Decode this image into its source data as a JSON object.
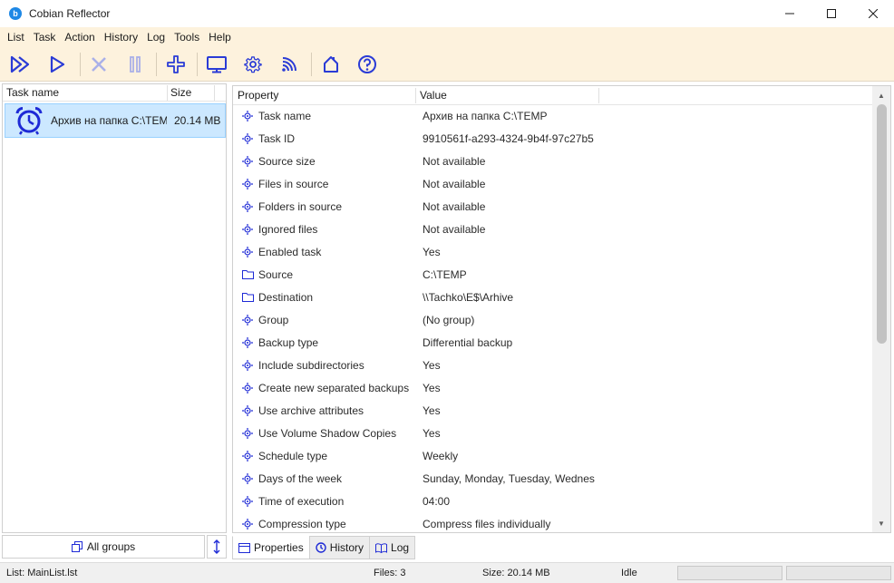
{
  "window": {
    "title": "Cobian Reflector",
    "app_icon_glyph": "b"
  },
  "menu": [
    "List",
    "Task",
    "Action",
    "History",
    "Log",
    "Tools",
    "Help"
  ],
  "toolbar_icons": [
    "run-all-icon",
    "run-icon",
    "stop-icon",
    "pause-icon",
    "add-task-icon",
    "monitor-icon",
    "settings-gear-icon",
    "network-signal-icon",
    "home-icon",
    "help-icon"
  ],
  "task_list": {
    "columns": {
      "name": "Task name",
      "size": "Size"
    },
    "tasks": [
      {
        "name": "Архив на папка C:\\TEMP",
        "size": "20.14 MB",
        "icon": "alarm-clock-icon"
      }
    ],
    "groups_button": "All groups"
  },
  "properties": {
    "columns": {
      "property": "Property",
      "value": "Value"
    },
    "rows": [
      {
        "name": "Task name",
        "value": "Архив на папка C:\\TEMP",
        "icon": "property-icon"
      },
      {
        "name": "Task ID",
        "value": "9910561f-a293-4324-9b4f-97c27b5",
        "icon": "property-icon"
      },
      {
        "name": "Source size",
        "value": "Not available",
        "icon": "property-icon"
      },
      {
        "name": "Files in source",
        "value": "Not available",
        "icon": "property-icon"
      },
      {
        "name": "Folders in source",
        "value": "Not available",
        "icon": "property-icon"
      },
      {
        "name": "Ignored files",
        "value": "Not available",
        "icon": "property-icon"
      },
      {
        "name": "Enabled task",
        "value": "Yes",
        "icon": "property-icon"
      },
      {
        "name": "Source",
        "value": "C:\\TEMP",
        "icon": "folder-icon"
      },
      {
        "name": "Destination",
        "value": "\\\\Tachko\\E$\\Arhive",
        "icon": "folder-icon"
      },
      {
        "name": "Group",
        "value": "(No group)",
        "icon": "property-icon"
      },
      {
        "name": "Backup type",
        "value": "Differential backup",
        "icon": "property-icon"
      },
      {
        "name": "Include subdirectories",
        "value": "Yes",
        "icon": "property-icon"
      },
      {
        "name": "Create new separated backups",
        "value": "Yes",
        "icon": "property-icon"
      },
      {
        "name": "Use archive attributes",
        "value": "Yes",
        "icon": "property-icon"
      },
      {
        "name": "Use Volume Shadow Copies",
        "value": "Yes",
        "icon": "property-icon"
      },
      {
        "name": "Schedule type",
        "value": "Weekly",
        "icon": "property-icon"
      },
      {
        "name": "Days of the week",
        "value": "Sunday, Monday, Tuesday, Wednesday",
        "icon": "property-icon"
      },
      {
        "name": "Time of execution",
        "value": "04:00",
        "icon": "property-icon"
      },
      {
        "name": "Compression type",
        "value": "Compress files individually",
        "icon": "property-icon"
      }
    ]
  },
  "tabs": [
    "Properties",
    "History",
    "Log"
  ],
  "status": {
    "list": "List: MainList.lst",
    "files": "Files: 3",
    "size": "Size: 20.14 MB",
    "state": "Idle"
  },
  "colors": {
    "toolbar_bg": "#fdf2dd",
    "icon_blue": "#2a3bd6",
    "disabled_icon": "#aab0e8",
    "selection": "#cce8ff"
  }
}
